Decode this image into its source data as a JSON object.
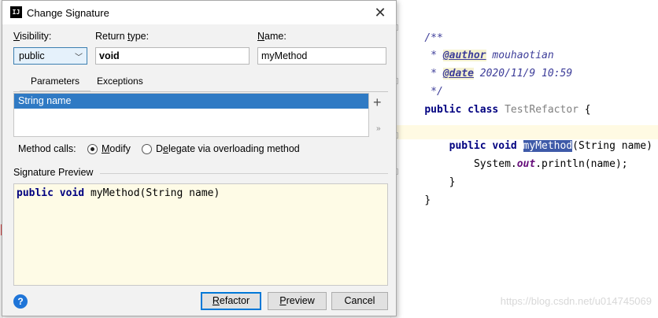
{
  "dialog": {
    "title": "Change Signature",
    "visibility_label_u": "V",
    "visibility_label_rest": "isibility:",
    "visibility_value": "public",
    "return_type_label_a": "Return ",
    "return_type_label_u": "t",
    "return_type_label_b": "ype:",
    "return_type_value": "void",
    "name_label_u": "N",
    "name_label_rest": "ame:",
    "name_value": "myMethod",
    "tabs": {
      "parameters": "Parameters",
      "exceptions": "Exceptions"
    },
    "parameters": [
      {
        "text": "String name"
      }
    ],
    "add_symbol": "+",
    "more_symbol": "»",
    "method_calls_label": "Method calls:",
    "modify_label_u": "M",
    "modify_label_rest": "odify",
    "delegate_label_a": "D",
    "delegate_label_u": "e",
    "delegate_label_b": "legate via overloading method",
    "selected_method_call": "modify",
    "signature_preview_label": "Signature Preview",
    "signature_preview": {
      "kw1": "public",
      "kw2": "void",
      "rest": "myMethod(String name)"
    },
    "buttons": {
      "refactor_u": "R",
      "refactor_rest": "efactor",
      "preview_u": "P",
      "preview_rest": "review",
      "cancel": "Cancel",
      "help": "?"
    }
  },
  "editor": {
    "doc_open": "/**",
    "doc_author_prefix": " * ",
    "doc_author_tag": "@author",
    "doc_author_value": " mouhaotian",
    "doc_date_prefix": " * ",
    "doc_date_tag": "@date",
    "doc_date_value": " 2020/11/9 10:59",
    "doc_close": " */",
    "class_kw": "public class ",
    "class_name": "TestRefactor",
    "class_brace": " {",
    "method_indent": "    ",
    "method_kw": "public void ",
    "method_name": "myMethod",
    "method_rest": "(String name) {",
    "call_indent": "        ",
    "call_a": "System.",
    "call_field": "out",
    "call_b": ".println(name);",
    "method_close": "    }",
    "class_close": "}"
  },
  "watermark": "https://blog.csdn.net/u014745069"
}
